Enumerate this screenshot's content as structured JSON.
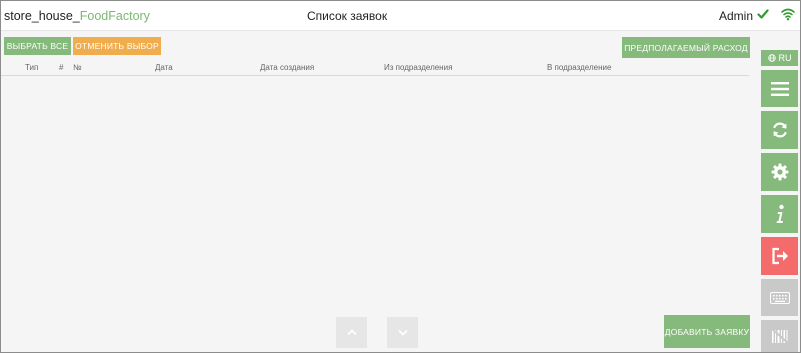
{
  "header": {
    "brand_prefix": "store_house_",
    "brand_accent": "FoodFactory",
    "title": "Список заявок",
    "user": "Admin",
    "status_icons": [
      "check-icon",
      "wifi-icon"
    ]
  },
  "toolbar": {
    "select_all": "ВЫБРАТЬ ВСЕ",
    "deselect": "ОТМЕНИТЬ ВЫБОР",
    "expected_expense": "ПРЕДПОЛАГАЕМЫЙ РАСХОД"
  },
  "table": {
    "columns": [
      "Тип",
      "#",
      "№",
      "Дата",
      "Дата создания",
      "Из подразделения",
      "В подразделение"
    ],
    "rows": []
  },
  "sidebar": {
    "language": "RU",
    "items": [
      "menu-icon",
      "sync-icon",
      "settings-icon",
      "info-icon",
      "logout-icon",
      "keyboard-icon",
      "barcode-icon"
    ]
  },
  "footer": {
    "add_request": "ДОБАВИТЬ ЗАЯВКУ",
    "nav": [
      "chevron-up-icon",
      "chevron-down-icon"
    ]
  },
  "colors": {
    "accent_green": "#86b97c",
    "brand_green": "#7cb773",
    "orange": "#f0ad4e",
    "red": "#f46b6b",
    "disabled_grey": "#c9c9c9"
  }
}
